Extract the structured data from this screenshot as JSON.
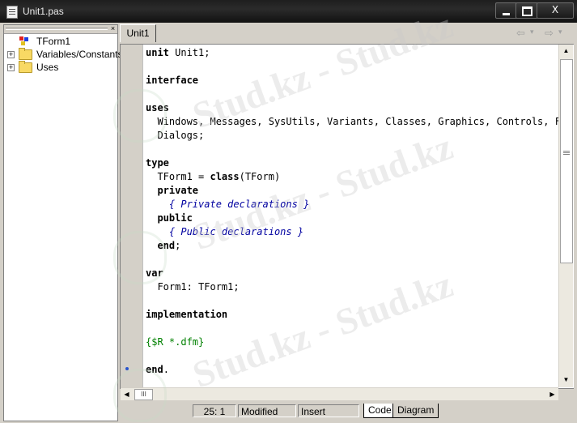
{
  "window": {
    "title": "Unit1.pas",
    "minimize_icon": "minimize-icon",
    "maximize_icon": "maximize-icon",
    "close_label": "X"
  },
  "explorer": {
    "close_label": "×",
    "items": [
      {
        "label": "TForm1",
        "icon": "class-icon",
        "expand": ""
      },
      {
        "label": "Variables/Constants",
        "icon": "folder-icon",
        "expand": "+"
      },
      {
        "label": "Uses",
        "icon": "folder-icon",
        "expand": "+"
      }
    ]
  },
  "editor": {
    "tab": "Unit1",
    "nav_back_glyph": "⇦",
    "nav_fwd_glyph": "⇨",
    "dropdown_glyph": "▾",
    "lines": [
      [
        {
          "t": "unit",
          "k": "kw"
        },
        {
          "t": " Unit1;",
          "k": ""
        }
      ],
      [],
      [
        {
          "t": "interface",
          "k": "kw"
        }
      ],
      [],
      [
        {
          "t": "uses",
          "k": "kw"
        }
      ],
      [
        {
          "t": "  Windows, Messages, SysUtils, Variants, Classes, Graphics, Controls, Forms,",
          "k": ""
        }
      ],
      [
        {
          "t": "  Dialogs;",
          "k": ""
        }
      ],
      [],
      [
        {
          "t": "type",
          "k": "kw"
        }
      ],
      [
        {
          "t": "  TForm1 = ",
          "k": ""
        },
        {
          "t": "class",
          "k": "kw"
        },
        {
          "t": "(TForm)",
          "k": ""
        }
      ],
      [
        {
          "t": "  ",
          "k": ""
        },
        {
          "t": "private",
          "k": "kw"
        }
      ],
      [
        {
          "t": "    { Private declarations }",
          "k": "cm"
        }
      ],
      [
        {
          "t": "  ",
          "k": ""
        },
        {
          "t": "public",
          "k": "kw"
        }
      ],
      [
        {
          "t": "    { Public declarations }",
          "k": "cm"
        }
      ],
      [
        {
          "t": "  ",
          "k": ""
        },
        {
          "t": "end",
          "k": "kw"
        },
        {
          "t": ";",
          "k": ""
        }
      ],
      [],
      [
        {
          "t": "var",
          "k": "kw"
        }
      ],
      [
        {
          "t": "  Form1: TForm1;",
          "k": ""
        }
      ],
      [],
      [
        {
          "t": "implementation",
          "k": "kw"
        }
      ],
      [],
      [
        {
          "t": "{$R *.dfm}",
          "k": "dir"
        }
      ],
      [],
      [
        {
          "t": "end",
          "k": "kw"
        },
        {
          "t": ".",
          "k": ""
        }
      ]
    ]
  },
  "scrollbars": {
    "up": "▲",
    "down": "▼",
    "left": "◀",
    "right": "▶",
    "grip": "III"
  },
  "status": {
    "position": "25:  1",
    "modified": "Modified",
    "mode": "Insert",
    "tabs": [
      "Code",
      "Diagram"
    ],
    "active_tab": "Code"
  },
  "watermark": "Stud.kz - Stud.kz"
}
